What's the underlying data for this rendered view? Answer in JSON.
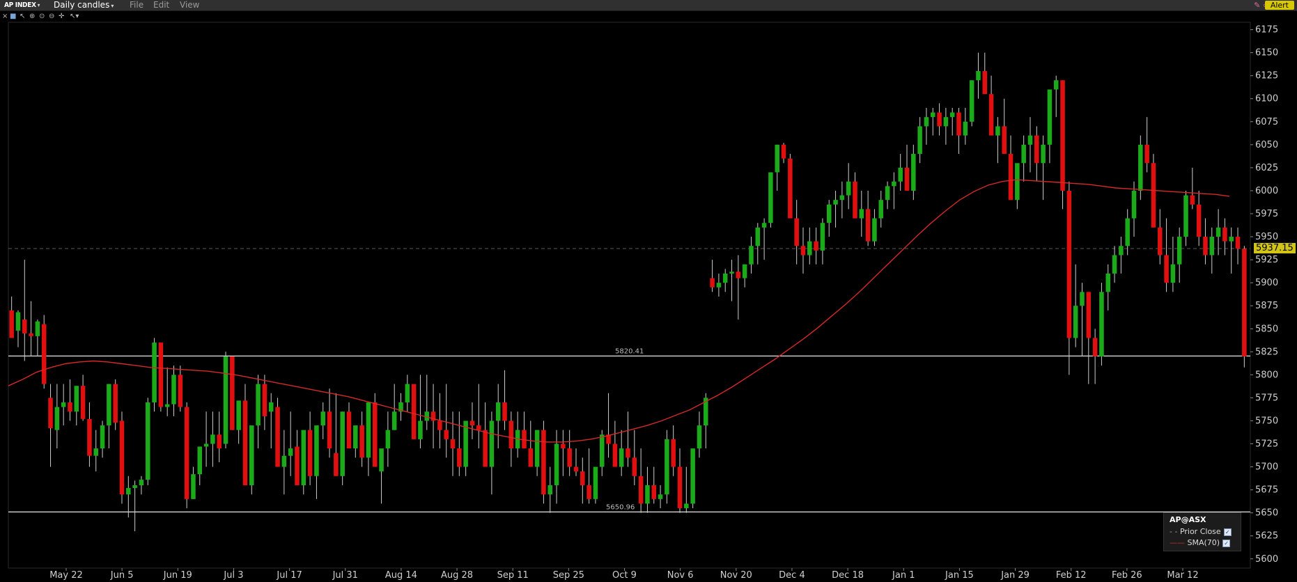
{
  "window": {
    "symbol": "AP INDEX",
    "period": "Daily candles",
    "menus": [
      "File",
      "Edit",
      "View"
    ],
    "alert_label": "Alert"
  },
  "legend": {
    "title": "AP@ASX",
    "items": [
      {
        "label": "Prior Close",
        "color": "#9a9a9a",
        "style": "dashed"
      },
      {
        "label": "SMA(70)",
        "color": "#e0232d",
        "style": "solid"
      }
    ]
  },
  "chart_data": {
    "type": "candlestick",
    "y_ticks": [
      5600,
      5625,
      5650,
      5675,
      5700,
      5725,
      5750,
      5775,
      5800,
      5825,
      5850,
      5875,
      5900,
      5925,
      5950,
      5975,
      6000,
      6025,
      6050,
      6075,
      6100,
      6125,
      6150,
      6175
    ],
    "ylim": [
      5590,
      6183
    ],
    "x_labels": [
      "May 22",
      "Jun 5",
      "Jun 19",
      "Jul 3",
      "Jul 17",
      "Jul 31",
      "Aug 14",
      "Aug 28",
      "Sep 11",
      "Sep 25",
      "Oct 9",
      "Nov 6",
      "Nov 20",
      "Dec 4",
      "Dec 18",
      "Jan 1",
      "Jan 15",
      "Jan 29",
      "Feb 12",
      "Feb 26",
      "Mar 12"
    ],
    "last_price": "5937.15",
    "last_price_value": 5937.15,
    "horizontal_lines": [
      {
        "value": 5820.41,
        "label": "5820.41"
      },
      {
        "value": 5650.96,
        "label": "5650.96"
      }
    ],
    "colors": {
      "up": "#1aaa1a",
      "down": "#e01010",
      "sma": "#d42a2a",
      "wick": "#cfcfcf",
      "hline": "#e8e8e8"
    },
    "sma_70": [
      5788,
      5795,
      5803,
      5808,
      5812,
      5814,
      5815,
      5814,
      5812,
      5810,
      5808,
      5807,
      5806,
      5805,
      5804,
      5802,
      5800,
      5797,
      5794,
      5791,
      5788,
      5785,
      5782,
      5779,
      5776,
      5772,
      5768,
      5764,
      5760,
      5756,
      5752,
      5748,
      5744,
      5740,
      5736,
      5733,
      5730,
      5728,
      5727,
      5727,
      5728,
      5730,
      5733,
      5737,
      5741,
      5745,
      5750,
      5756,
      5762,
      5770,
      5778,
      5787,
      5797,
      5807,
      5817,
      5828,
      5839,
      5851,
      5864,
      5877,
      5891,
      5906,
      5921,
      5936,
      5951,
      5965,
      5978,
      5990,
      5999,
      6006,
      6010,
      6012,
      6011,
      6010,
      6009,
      6008,
      6007,
      6005,
      6003,
      6002,
      6001,
      6000,
      5999,
      5998,
      5997,
      5996,
      5994
    ],
    "candles": [
      [
        5870,
        5885,
        5840,
        5840
      ],
      [
        5848,
        5870,
        5830,
        5868
      ],
      [
        5860,
        5925,
        5815,
        5845
      ],
      [
        5845,
        5880,
        5820,
        5842
      ],
      [
        5842,
        5860,
        5820,
        5858
      ],
      [
        5855,
        5865,
        5785,
        5790
      ],
      [
        5775,
        5790,
        5700,
        5742
      ],
      [
        5740,
        5790,
        5720,
        5765
      ],
      [
        5765,
        5790,
        5745,
        5770
      ],
      [
        5770,
        5795,
        5750,
        5760
      ],
      [
        5760,
        5785,
        5745,
        5788
      ],
      [
        5788,
        5800,
        5750,
        5752
      ],
      [
        5752,
        5770,
        5700,
        5712
      ],
      [
        5712,
        5740,
        5695,
        5720
      ],
      [
        5720,
        5750,
        5710,
        5745
      ],
      [
        5745,
        5790,
        5720,
        5790
      ],
      [
        5790,
        5795,
        5740,
        5748
      ],
      [
        5750,
        5760,
        5660,
        5670
      ],
      [
        5670,
        5690,
        5645,
        5677
      ],
      [
        5677,
        5685,
        5630,
        5680
      ],
      [
        5680,
        5690,
        5670,
        5686
      ],
      [
        5686,
        5775,
        5680,
        5770
      ],
      [
        5770,
        5840,
        5760,
        5835
      ],
      [
        5835,
        5810,
        5760,
        5765
      ],
      [
        5765,
        5808,
        5755,
        5768
      ],
      [
        5768,
        5810,
        5755,
        5800
      ],
      [
        5800,
        5810,
        5760,
        5765
      ],
      [
        5765,
        5770,
        5655,
        5665
      ],
      [
        5665,
        5700,
        5665,
        5692
      ],
      [
        5692,
        5710,
        5680,
        5722
      ],
      [
        5722,
        5760,
        5700,
        5725
      ],
      [
        5725,
        5760,
        5700,
        5735
      ],
      [
        5735,
        5760,
        5705,
        5720
      ],
      [
        5725,
        5825,
        5720,
        5820
      ],
      [
        5820,
        5820,
        5740,
        5740
      ],
      [
        5740,
        5770,
        5725,
        5772
      ],
      [
        5772,
        5790,
        5700,
        5680
      ],
      [
        5680,
        5720,
        5670,
        5745
      ],
      [
        5745,
        5800,
        5720,
        5790
      ],
      [
        5790,
        5800,
        5740,
        5755
      ],
      [
        5760,
        5780,
        5720,
        5770
      ],
      [
        5765,
        5775,
        5700,
        5700
      ],
      [
        5700,
        5740,
        5670,
        5712
      ],
      [
        5712,
        5760,
        5690,
        5720
      ],
      [
        5722,
        5740,
        5680,
        5680
      ],
      [
        5680,
        5695,
        5670,
        5740
      ],
      [
        5740,
        5760,
        5680,
        5690
      ],
      [
        5690,
        5710,
        5665,
        5745
      ],
      [
        5745,
        5770,
        5730,
        5760
      ],
      [
        5760,
        5785,
        5710,
        5720
      ],
      [
        5715,
        5780,
        5690,
        5690
      ],
      [
        5690,
        5760,
        5680,
        5760
      ],
      [
        5760,
        5770,
        5720,
        5720
      ],
      [
        5720,
        5740,
        5710,
        5745
      ],
      [
        5745,
        5760,
        5700,
        5710
      ],
      [
        5710,
        5760,
        5690,
        5770
      ],
      [
        5770,
        5780,
        5700,
        5700
      ],
      [
        5695,
        5710,
        5660,
        5720
      ],
      [
        5720,
        5760,
        5700,
        5740
      ],
      [
        5740,
        5790,
        5740,
        5760
      ],
      [
        5760,
        5780,
        5750,
        5770
      ],
      [
        5770,
        5800,
        5760,
        5790
      ],
      [
        5790,
        5785,
        5730,
        5730
      ],
      [
        5730,
        5800,
        5720,
        5750
      ],
      [
        5750,
        5800,
        5740,
        5760
      ],
      [
        5760,
        5790,
        5720,
        5750
      ],
      [
        5750,
        5780,
        5720,
        5740
      ],
      [
        5740,
        5790,
        5710,
        5730
      ],
      [
        5730,
        5760,
        5690,
        5720
      ],
      [
        5720,
        5760,
        5690,
        5700
      ],
      [
        5700,
        5740,
        5690,
        5750
      ],
      [
        5750,
        5770,
        5730,
        5745
      ],
      [
        5745,
        5790,
        5720,
        5740
      ],
      [
        5740,
        5770,
        5720,
        5700
      ],
      [
        5700,
        5760,
        5670,
        5750
      ],
      [
        5750,
        5790,
        5720,
        5770
      ],
      [
        5770,
        5805,
        5740,
        5750
      ],
      [
        5750,
        5760,
        5700,
        5720
      ],
      [
        5720,
        5760,
        5710,
        5740
      ],
      [
        5740,
        5760,
        5720,
        5720
      ],
      [
        5720,
        5750,
        5700,
        5700
      ],
      [
        5700,
        5740,
        5690,
        5740
      ],
      [
        5740,
        5750,
        5660,
        5670
      ],
      [
        5670,
        5700,
        5650,
        5680
      ],
      [
        5680,
        5740,
        5660,
        5725
      ],
      [
        5725,
        5740,
        5690,
        5720
      ],
      [
        5720,
        5740,
        5690,
        5700
      ],
      [
        5700,
        5720,
        5690,
        5695
      ],
      [
        5695,
        5710,
        5660,
        5680
      ],
      [
        5680,
        5720,
        5660,
        5665
      ],
      [
        5665,
        5700,
        5660,
        5700
      ],
      [
        5700,
        5740,
        5690,
        5735
      ],
      [
        5735,
        5780,
        5710,
        5725
      ],
      [
        5725,
        5750,
        5700,
        5700
      ],
      [
        5700,
        5740,
        5690,
        5720
      ],
      [
        5720,
        5760,
        5700,
        5710
      ],
      [
        5710,
        5740,
        5680,
        5690
      ],
      [
        5690,
        5720,
        5650,
        5660
      ],
      [
        5660,
        5700,
        5650,
        5680
      ],
      [
        5680,
        5700,
        5660,
        5665
      ],
      [
        5665,
        5680,
        5655,
        5670
      ],
      [
        5670,
        5740,
        5660,
        5730
      ],
      [
        5730,
        5745,
        5690,
        5700
      ],
      [
        5700,
        5720,
        5650,
        5655
      ],
      [
        5655,
        5700,
        5650,
        5660
      ],
      [
        5660,
        5700,
        5655,
        5720
      ],
      [
        5720,
        5760,
        5710,
        5745
      ],
      [
        5745,
        5780,
        5720,
        5775
      ],
      [
        5905,
        5925,
        5890,
        5895
      ],
      [
        5895,
        5910,
        5885,
        5900
      ],
      [
        5900,
        5915,
        5890,
        5910
      ],
      [
        5910,
        5925,
        5880,
        5912
      ],
      [
        5912,
        5930,
        5860,
        5905
      ],
      [
        5905,
        5920,
        5895,
        5920
      ],
      [
        5920,
        5950,
        5910,
        5940
      ],
      [
        5940,
        5965,
        5920,
        5960
      ],
      [
        5960,
        5970,
        5925,
        5965
      ],
      [
        5965,
        6020,
        5960,
        6020
      ],
      [
        6020,
        6050,
        6000,
        6050
      ],
      [
        6050,
        6052,
        6030,
        6035
      ],
      [
        6035,
        6040,
        5990,
        5970
      ],
      [
        5970,
        5990,
        5920,
        5940
      ],
      [
        5940,
        5960,
        5910,
        5930
      ],
      [
        5930,
        5960,
        5920,
        5945
      ],
      [
        5945,
        5960,
        5920,
        5935
      ],
      [
        5935,
        5970,
        5920,
        5965
      ],
      [
        5965,
        5990,
        5950,
        5985
      ],
      [
        5985,
        6000,
        5960,
        5990
      ],
      [
        5990,
        6010,
        5970,
        5995
      ],
      [
        5995,
        6030,
        5980,
        6010
      ],
      [
        6010,
        6020,
        5970,
        5970
      ],
      [
        5970,
        6000,
        5950,
        5980
      ],
      [
        5980,
        6000,
        5940,
        5945
      ],
      [
        5945,
        5980,
        5940,
        5970
      ],
      [
        5970,
        6000,
        5960,
        5990
      ],
      [
        5990,
        6010,
        5980,
        6005
      ],
      [
        6005,
        6020,
        5980,
        6010
      ],
      [
        6010,
        6040,
        6000,
        6025
      ],
      [
        6025,
        6050,
        6000,
        6000
      ],
      [
        6000,
        6050,
        5990,
        6040
      ],
      [
        6040,
        6080,
        6030,
        6070
      ],
      [
        6070,
        6090,
        6050,
        6080
      ],
      [
        6080,
        6090,
        6060,
        6085
      ],
      [
        6085,
        6095,
        6060,
        6070
      ],
      [
        6070,
        6090,
        6050,
        6080
      ],
      [
        6080,
        6090,
        6060,
        6085
      ],
      [
        6085,
        6090,
        6040,
        6060
      ],
      [
        6060,
        6090,
        6050,
        6075
      ],
      [
        6075,
        6120,
        6070,
        6120
      ],
      [
        6120,
        6150,
        6100,
        6130
      ],
      [
        6130,
        6150,
        6110,
        6105
      ],
      [
        6105,
        6125,
        6070,
        6060
      ],
      [
        6060,
        6080,
        6030,
        6070
      ],
      [
        6070,
        6100,
        6050,
        6040
      ],
      [
        6040,
        6060,
        5990,
        5990
      ],
      [
        5990,
        6020,
        5980,
        6030
      ],
      [
        6030,
        6060,
        6010,
        6050
      ],
      [
        6050,
        6080,
        6020,
        6060
      ],
      [
        6060,
        6070,
        6010,
        6030
      ],
      [
        6030,
        6060,
        5990,
        6050
      ],
      [
        6050,
        6100,
        6030,
        6110
      ],
      [
        6110,
        6125,
        6080,
        6120
      ],
      [
        6120,
        6120,
        5980,
        6000
      ],
      [
        6000,
        6010,
        5800,
        5840
      ],
      [
        5840,
        5920,
        5830,
        5875
      ],
      [
        5875,
        5900,
        5820,
        5890
      ],
      [
        5890,
        5890,
        5790,
        5840
      ],
      [
        5840,
        5850,
        5790,
        5820
      ],
      [
        5820,
        5900,
        5810,
        5890
      ],
      [
        5890,
        5920,
        5870,
        5910
      ],
      [
        5910,
        5940,
        5900,
        5930
      ],
      [
        5930,
        5950,
        5910,
        5940
      ],
      [
        5940,
        5980,
        5930,
        5970
      ],
      [
        5970,
        6010,
        5950,
        6000
      ],
      [
        6000,
        6060,
        5990,
        6050
      ],
      [
        6050,
        6080,
        6020,
        6030
      ],
      [
        6030,
        6040,
        5990,
        5960
      ],
      [
        5960,
        5980,
        5920,
        5930
      ],
      [
        5930,
        5970,
        5890,
        5900
      ],
      [
        5900,
        5950,
        5890,
        5920
      ],
      [
        5920,
        5960,
        5900,
        5950
      ],
      [
        5950,
        6000,
        5940,
        5995
      ],
      [
        5995,
        6025,
        5980,
        5985
      ],
      [
        5985,
        6000,
        5940,
        5950
      ],
      [
        5950,
        5970,
        5920,
        5930
      ],
      [
        5930,
        5960,
        5910,
        5950
      ],
      [
        5950,
        5980,
        5930,
        5960
      ],
      [
        5960,
        5970,
        5930,
        5945
      ],
      [
        5945,
        5960,
        5910,
        5950
      ],
      [
        5950,
        5960,
        5920,
        5937
      ],
      [
        5937,
        5940,
        5808,
        5820
      ]
    ]
  }
}
